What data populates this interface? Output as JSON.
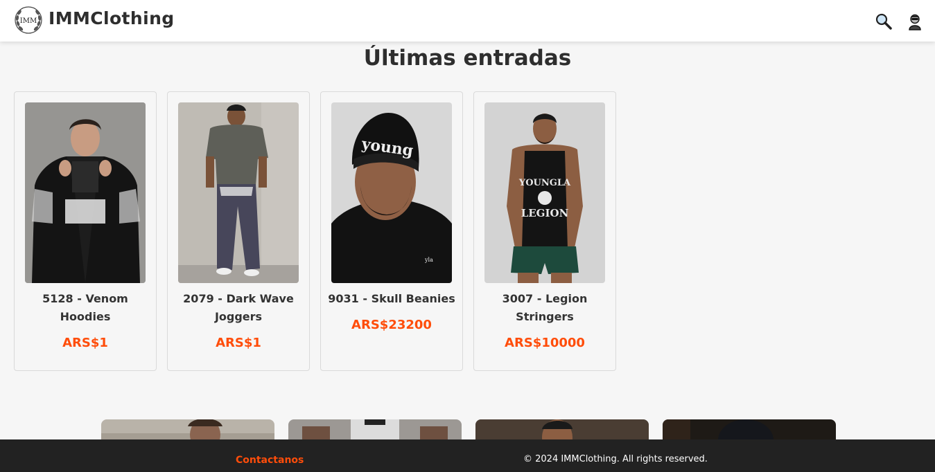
{
  "header": {
    "logo_text": "IMM",
    "brand": "IMMClothing",
    "icons": [
      "search-icon",
      "user-icon"
    ]
  },
  "section_title": "Últimas entradas",
  "products": [
    {
      "name": "5128 - Venom Hoodies",
      "price": "ARS$1"
    },
    {
      "name": "2079 - Dark Wave Joggers",
      "price": "ARS$1"
    },
    {
      "name": "9031 - Skull Beanies",
      "price": "ARS$23200"
    },
    {
      "name": "3007 - Legion Stringers",
      "price": "ARS$10000"
    }
  ],
  "footer": {
    "contact_label": "Contactanos",
    "copyright": "© 2024 IMMClothing. All rights reserved."
  },
  "colors": {
    "accent": "#ff4d0a",
    "footer_bg": "#222222",
    "page_bg": "#f6f6f6"
  }
}
